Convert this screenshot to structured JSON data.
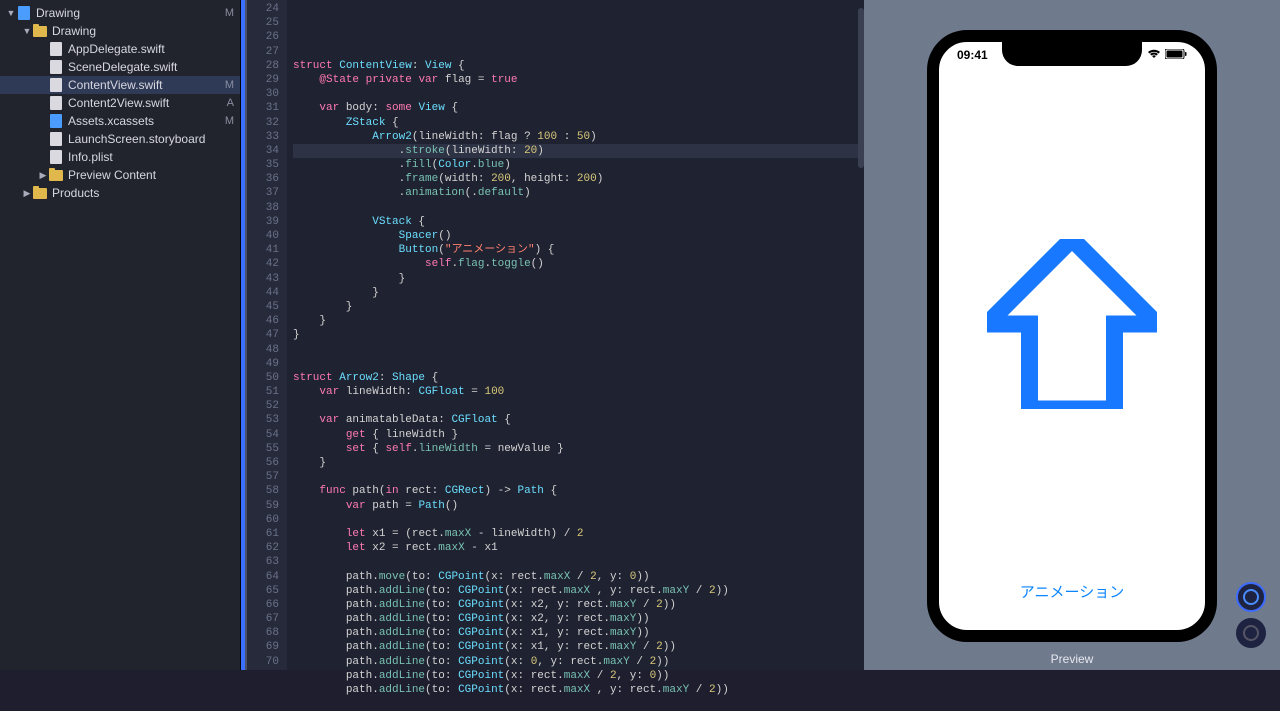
{
  "navigator": {
    "items": [
      {
        "indent": 0,
        "disclosure": "▼",
        "icon": "proj",
        "label": "Drawing",
        "status": "M"
      },
      {
        "indent": 1,
        "disclosure": "▼",
        "icon": "folder",
        "label": "Drawing",
        "status": ""
      },
      {
        "indent": 2,
        "disclosure": "",
        "icon": "swift",
        "label": "AppDelegate.swift",
        "status": ""
      },
      {
        "indent": 2,
        "disclosure": "",
        "icon": "swift",
        "label": "SceneDelegate.swift",
        "status": ""
      },
      {
        "indent": 2,
        "disclosure": "",
        "icon": "swift",
        "label": "ContentView.swift",
        "status": "M",
        "selected": true
      },
      {
        "indent": 2,
        "disclosure": "",
        "icon": "swift",
        "label": "Content2View.swift",
        "status": "A"
      },
      {
        "indent": 2,
        "disclosure": "",
        "icon": "asset",
        "label": "Assets.xcassets",
        "status": "M"
      },
      {
        "indent": 2,
        "disclosure": "",
        "icon": "sb",
        "label": "LaunchScreen.storyboard",
        "status": ""
      },
      {
        "indent": 2,
        "disclosure": "",
        "icon": "plist",
        "label": "Info.plist",
        "status": ""
      },
      {
        "indent": 2,
        "disclosure": "▶",
        "icon": "folder",
        "label": "Preview Content",
        "status": ""
      },
      {
        "indent": 1,
        "disclosure": "▶",
        "icon": "folder",
        "label": "Products",
        "status": ""
      }
    ]
  },
  "editor": {
    "first_line_number": 24,
    "selected_line": 31,
    "lines": [
      "",
      "struct ContentView: View {",
      "    @State private var flag = true",
      "",
      "    var body: some View {",
      "        ZStack {",
      "            Arrow2(lineWidth: flag ? 100 : 50)",
      "                .stroke(lineWidth: 20)",
      "                .fill(Color.blue)",
      "                .frame(width: 200, height: 200)",
      "                .animation(.default)",
      "",
      "            VStack {",
      "                Spacer()",
      "                Button(\"アニメーション\") {",
      "                    self.flag.toggle()",
      "                }",
      "            }",
      "        }",
      "    }",
      "}",
      "",
      "",
      "struct Arrow2: Shape {",
      "    var lineWidth: CGFloat = 100",
      "",
      "    var animatableData: CGFloat {",
      "        get { lineWidth }",
      "        set { self.lineWidth = newValue }",
      "    }",
      "",
      "    func path(in rect: CGRect) -> Path {",
      "        var path = Path()",
      "",
      "        let x1 = (rect.maxX - lineWidth) / 2",
      "        let x2 = rect.maxX - x1",
      "",
      "        path.move(to: CGPoint(x: rect.maxX / 2, y: 0))",
      "        path.addLine(to: CGPoint(x: rect.maxX , y: rect.maxY / 2))",
      "        path.addLine(to: CGPoint(x: x2, y: rect.maxY / 2))",
      "        path.addLine(to: CGPoint(x: x2, y: rect.maxY))",
      "        path.addLine(to: CGPoint(x: x1, y: rect.maxY))",
      "        path.addLine(to: CGPoint(x: x1, y: rect.maxY / 2))",
      "        path.addLine(to: CGPoint(x: 0, y: rect.maxY / 2))",
      "        path.addLine(to: CGPoint(x: rect.maxX / 2, y: 0))",
      "        path.addLine(to: CGPoint(x: rect.maxX , y: rect.maxY / 2))",
      ""
    ]
  },
  "preview": {
    "time": "09:41",
    "button_label": "アニメーション",
    "panel_label": "Preview",
    "arrow_color": "#1878ff"
  }
}
